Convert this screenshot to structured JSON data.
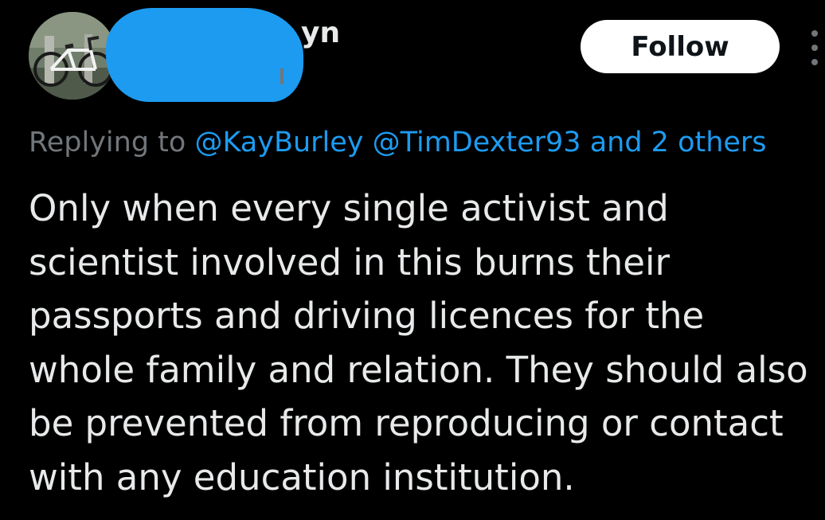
{
  "author": {
    "display_name_visible": "yn",
    "avatar_icon": "bicycle-photo-avatar",
    "redaction_color": "#1d9bf0"
  },
  "follow": {
    "label": "Follow"
  },
  "more_icon": "more-vertical-icon",
  "reply": {
    "prefix": "Replying to",
    "mention_1": "@KayBurley",
    "mention_2": "@TimDexter93",
    "others": "and 2 others"
  },
  "tweet": {
    "lines": [
      "Only when every single activist and",
      "scientist involved in this burns their",
      "passports and driving licences for the",
      "whole family and relation. They should also",
      "be prevented from reproducing or contact",
      "with any education institution."
    ]
  },
  "colors": {
    "background": "#000000",
    "text": "#e7e9ea",
    "secondary": "#71767b",
    "accent": "#1d9bf0",
    "button_bg": "#ffffff"
  }
}
